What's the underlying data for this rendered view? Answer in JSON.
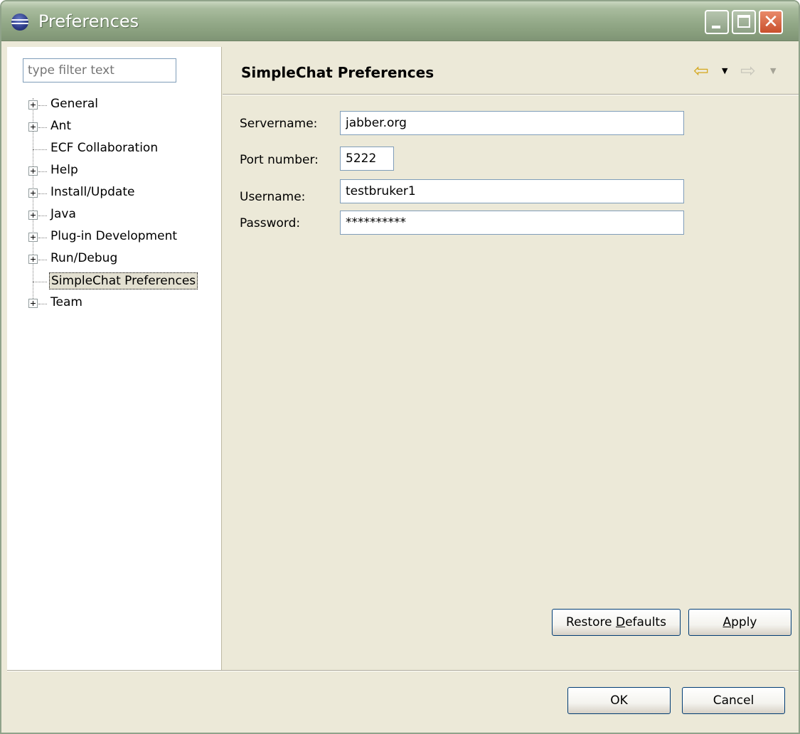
{
  "window": {
    "title": "Preferences",
    "controls": {
      "minimize_icon": "minimize-icon",
      "maximize_icon": "maximize-icon",
      "close_glyph": "✕"
    }
  },
  "sidebar": {
    "filter_placeholder": "type filter text",
    "items": [
      {
        "label": "General",
        "expandable": true
      },
      {
        "label": "Ant",
        "expandable": true
      },
      {
        "label": "ECF Collaboration",
        "expandable": false
      },
      {
        "label": "Help",
        "expandable": true
      },
      {
        "label": "Install/Update",
        "expandable": true
      },
      {
        "label": "Java",
        "expandable": true
      },
      {
        "label": "Plug-in Development",
        "expandable": true
      },
      {
        "label": "Run/Debug",
        "expandable": true
      },
      {
        "label": "SimpleChat Preferences",
        "expandable": false,
        "selected": true
      },
      {
        "label": "Team",
        "expandable": true
      }
    ]
  },
  "page": {
    "title": "SimpleChat Preferences",
    "nav": {
      "back_glyph": "⇦",
      "forward_glyph": "⇨",
      "dropdown_glyph": "▼"
    },
    "fields": {
      "servername": {
        "label": "Servername:",
        "value": "jabber.org"
      },
      "port": {
        "label": "Port number:",
        "value": "5222"
      },
      "username": {
        "label": "Username:",
        "value": "testbruker1"
      },
      "password": {
        "label": "Password:",
        "value": "**********"
      }
    },
    "buttons": {
      "restore_pre": "Restore ",
      "restore_mnemonic": "D",
      "restore_post": "efaults",
      "apply_mnemonic": "A",
      "apply_post": "pply"
    }
  },
  "dialog_buttons": {
    "ok": "OK",
    "cancel": "Cancel"
  },
  "colors": {
    "titlebar": "#93a988",
    "background": "#ece9d8",
    "selection": "#e3e0d1",
    "input_border": "#7f9db9"
  }
}
